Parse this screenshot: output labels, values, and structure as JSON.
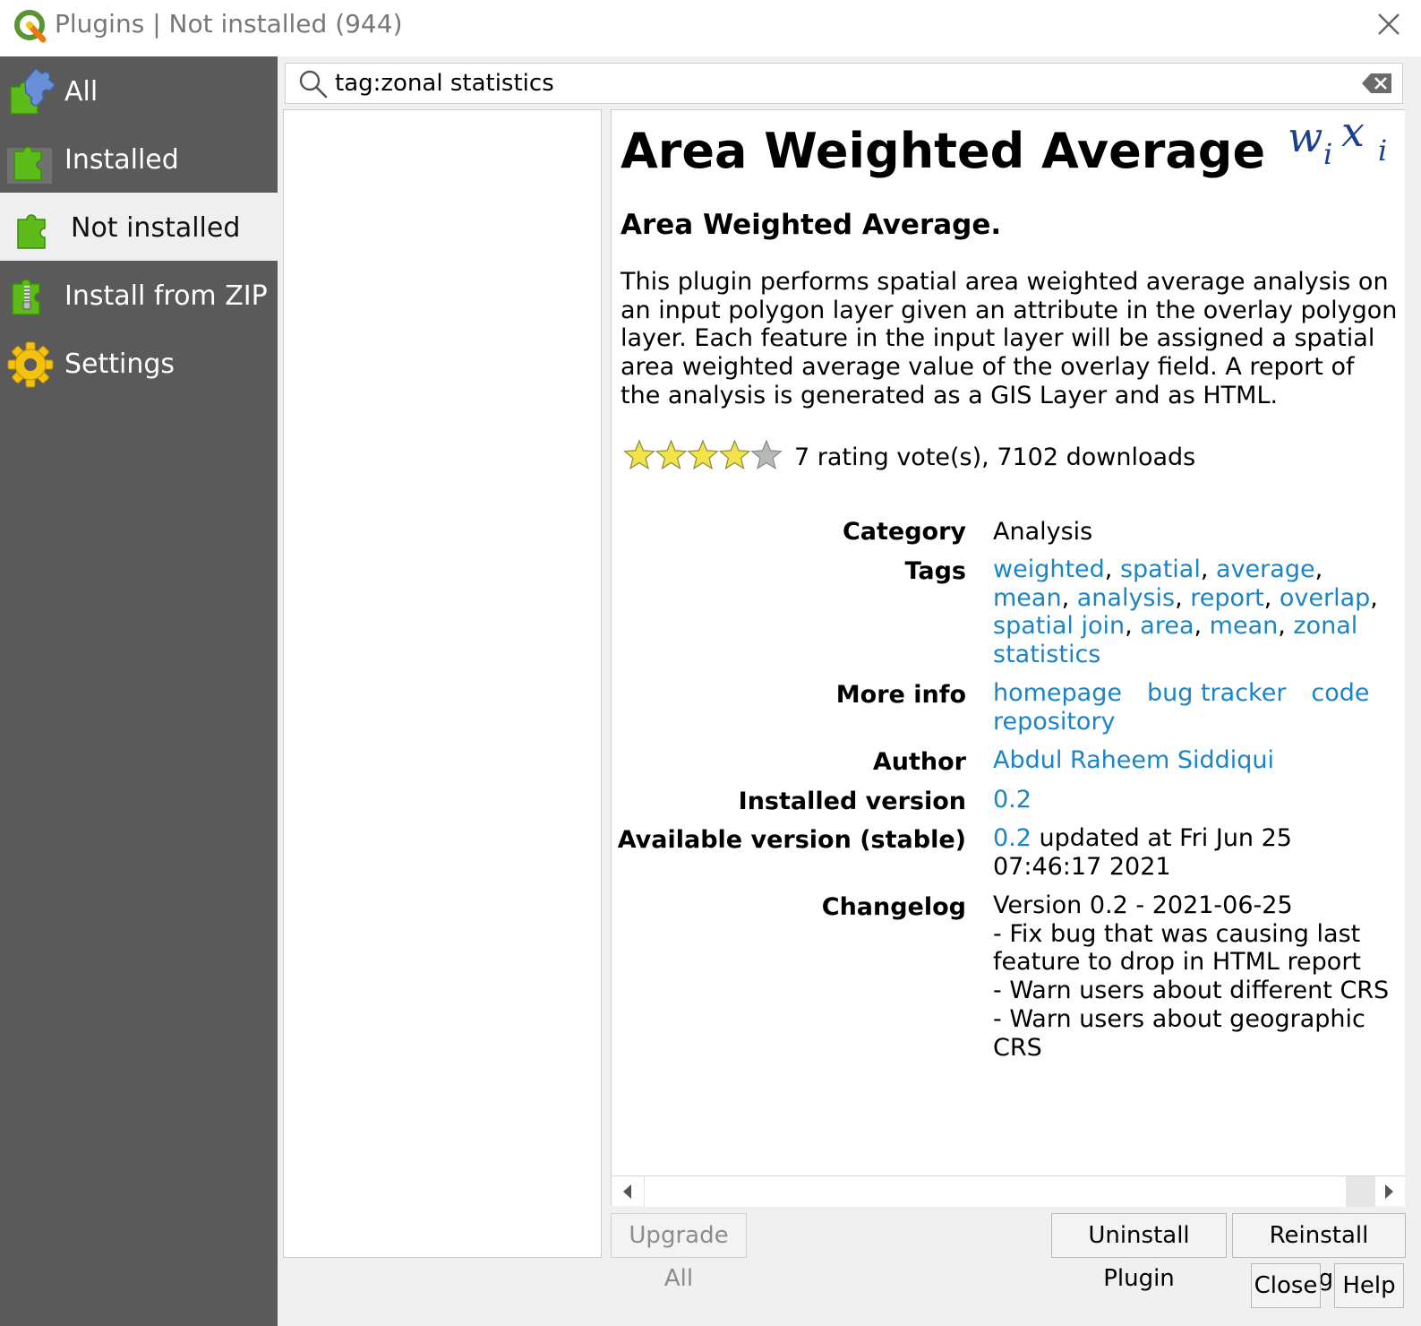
{
  "window": {
    "title": "Plugins | Not installed (944)"
  },
  "sidebar": {
    "items": [
      {
        "label": "All",
        "icon": "puzzle-all-icon"
      },
      {
        "label": "Installed",
        "icon": "puzzle-installed-icon"
      },
      {
        "label": "Not installed",
        "icon": "puzzle-not-installed-icon",
        "selected": true
      },
      {
        "label": "Install from ZIP",
        "icon": "zip-icon"
      },
      {
        "label": "Settings",
        "icon": "gear-icon"
      }
    ]
  },
  "search": {
    "value": "tag:zonal statistics"
  },
  "details": {
    "title": "Area Weighted Average",
    "subtitle": "Area Weighted Average.",
    "description": "This plugin performs spatial area weighted average analysis on an input polygon layer given an attribute in the overlay polygon layer. Each feature in the input layer will be assigned a spatial area weighted average value of the overlay field. A report of the analysis is generated as a GIS Layer and as HTML.",
    "rating_stars": 4,
    "rating_max": 5,
    "rating_text": "7 rating vote(s), 7102 downloads",
    "category_label": "Category",
    "category": "Analysis",
    "tags_label": "Tags",
    "tags": [
      "weighted",
      "spatial",
      "average",
      "mean",
      "analysis",
      "report",
      "overlap",
      "spatial join",
      "area",
      "mean",
      "zonal statistics"
    ],
    "more_info_label": "More info",
    "more_info_links": [
      "homepage",
      "bug tracker",
      "code repository"
    ],
    "author_label": "Author",
    "author": "Abdul Raheem Siddiqui",
    "installed_version_label": "Installed version",
    "installed_version": "0.2",
    "available_version_label": "Available version (stable)",
    "available_version": "0.2",
    "available_version_suffix": " updated at Fri Jun 25 07:46:17 2021",
    "changelog_label": "Changelog",
    "changelog": [
      "Version 0.2 - 2021-06-25",
      "- Fix bug that was causing last feature to drop in HTML report",
      "- Warn users about different CRS",
      "- Warn users about geographic CRS"
    ]
  },
  "buttons": {
    "upgrade_all": "Upgrade All",
    "uninstall": "Uninstall Plugin",
    "reinstall": "Reinstall Plugin",
    "close": "Close",
    "help": "Help"
  },
  "colors": {
    "sidebar_bg": "#5a5a5a",
    "link": "#1a84c7",
    "puzzle_green": "#5dbb1a"
  }
}
